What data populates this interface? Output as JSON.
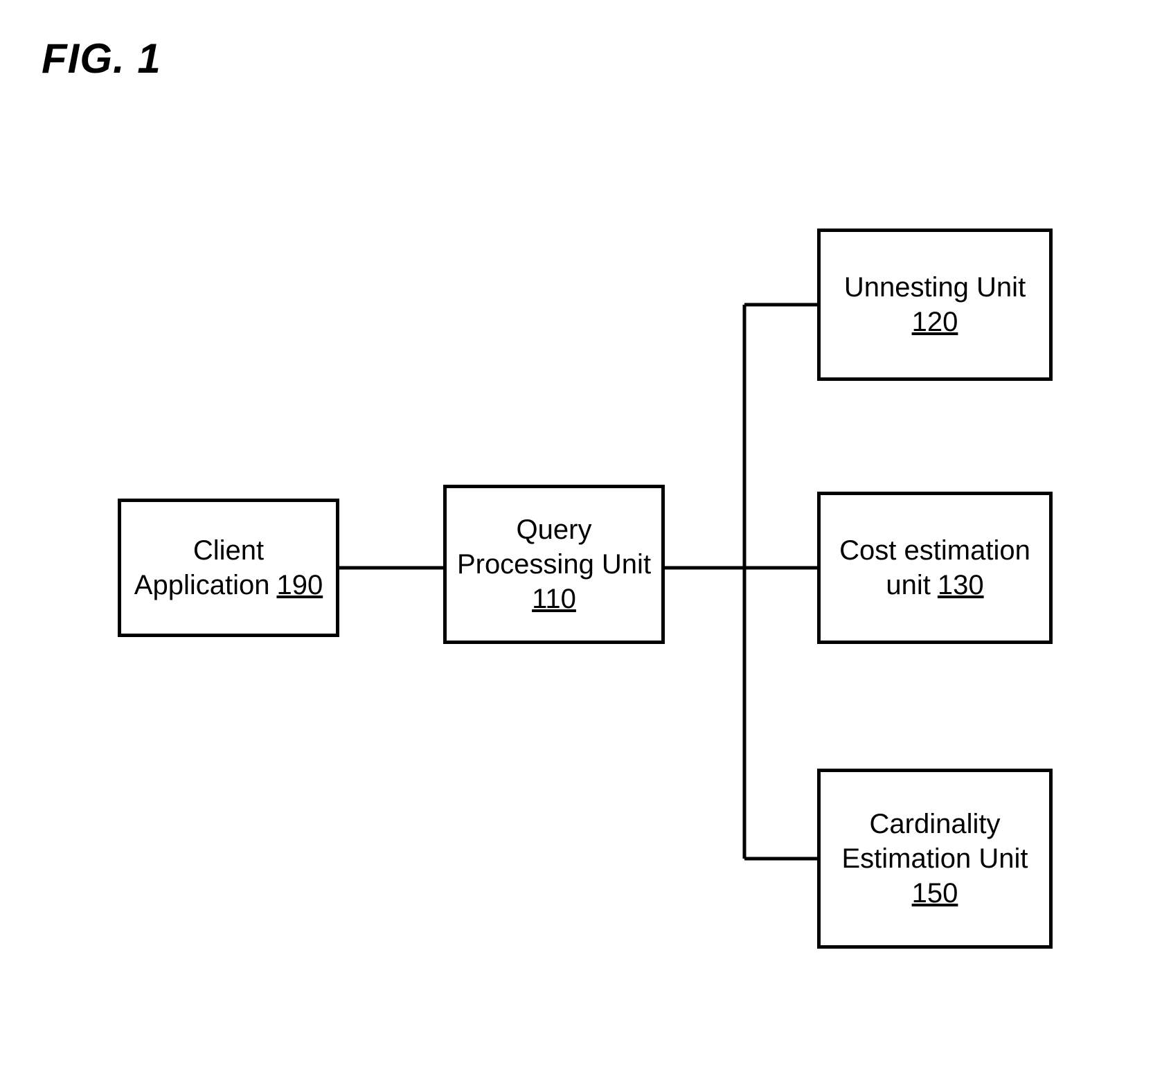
{
  "title": "FIG. 1",
  "boxes": {
    "client": {
      "line1": "Client",
      "line2_pre": "Application",
      "ref": "190"
    },
    "query": {
      "line1": "Query",
      "line2": "Processing Unit",
      "ref": "110"
    },
    "unnesting": {
      "line1": "Unnesting Unit",
      "ref": "120"
    },
    "cost": {
      "line1": "Cost estimation",
      "line2_pre": "unit",
      "ref": "130"
    },
    "cardinality": {
      "line1": "Cardinality",
      "line2": "Estimation Unit",
      "ref": "150"
    }
  }
}
